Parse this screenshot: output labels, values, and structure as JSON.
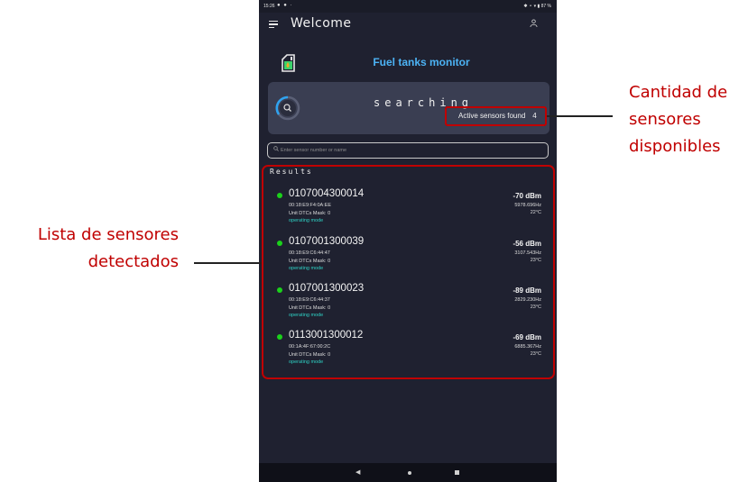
{
  "status_bar": {
    "time": "15:26",
    "notification_icons": "● ● ·",
    "right_text": "✱ ⚬ ▾ ▮ 87 %"
  },
  "app_bar": {
    "title": "Welcome",
    "menu_icon": "hamburger-icon",
    "profile_icon": "user-icon"
  },
  "brand": {
    "name": "Fuel tanks monitor",
    "logo_icon": "fuel-tank-icon",
    "color": "#4cb3f5"
  },
  "search_status": {
    "label": "searching",
    "found_label": "Active sensors found",
    "found_count": "4"
  },
  "search_input": {
    "placeholder": "Enter sensor number or name",
    "value": ""
  },
  "results": {
    "title": "Results",
    "sensors": [
      {
        "id": "0107004300014",
        "mac": "00:18:E9:F4:0A:EE",
        "mask": "Unit DTCs Mask: 0",
        "mode": "operating mode",
        "rssi": "-70 dBm",
        "frequency": "5978.696Hz",
        "temperature": "22°C"
      },
      {
        "id": "0107001300039",
        "mac": "00:18:E9:C6:44:47",
        "mask": "Unit DTCs Mask: 0",
        "mode": "operating mode",
        "rssi": "-56 dBm",
        "frequency": "3107.543Hz",
        "temperature": "23°C"
      },
      {
        "id": "0107001300023",
        "mac": "00:18:E9:C6:44:37",
        "mask": "Unit DTCs Mask: 0",
        "mode": "operating mode",
        "rssi": "-89 dBm",
        "frequency": "2829.230Hz",
        "temperature": "23°C"
      },
      {
        "id": "0113001300012",
        "mac": "00:1A:4F:67:00:2C",
        "mask": "Unit DTCs Mask: 0",
        "mode": "operating mode",
        "rssi": "-69 dBm",
        "frequency": "6885.367Hz",
        "temperature": "23°C"
      }
    ]
  },
  "nav_bar": {
    "back_icon": "back-triangle-icon",
    "home_icon": "home-circle-icon",
    "recent_icon": "recent-square-icon"
  },
  "annotations": {
    "right_lines": [
      "Cantidad de",
      "sensores",
      "disponibles"
    ],
    "left_lines": [
      "Lista de sensores",
      "detectados"
    ],
    "color": "#c00000"
  },
  "colors": {
    "background": "#1f2130",
    "card": "#3a3e52",
    "status_dot": "#1bd11b",
    "mode_text": "#2fd3c6"
  }
}
